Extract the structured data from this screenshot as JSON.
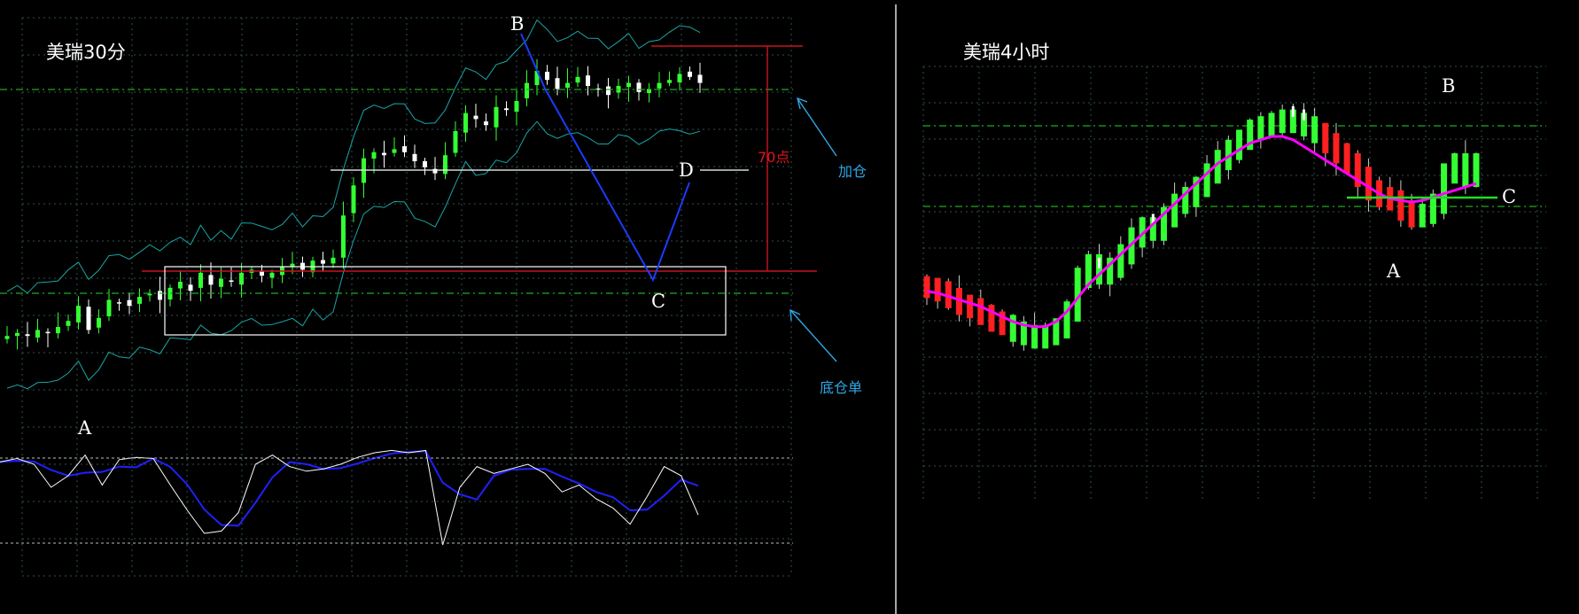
{
  "colors": {
    "background": "#000000",
    "bull_candle": "#33ff33",
    "bear_candle": "#ffffff",
    "bear_candle_4h": "#ff2020",
    "grid": "#2f4f4f",
    "band": "#1aa6a6",
    "stoch_main": "#ffffff",
    "stoch_signal": "#2020ff",
    "abcd_line": "#1a3cff",
    "level_red": "#c8141e",
    "level_green": "#22aa22",
    "annotation_cyan": "#2fa7e6",
    "ma_magenta": "#ff00ff",
    "divider": "#ffffff"
  },
  "left_panel": {
    "title": "美瑞30分",
    "labels": {
      "A": "A",
      "B": "B",
      "C": "C",
      "D": "D"
    },
    "distance_label": "70点",
    "add_position_label": "加仓",
    "base_position_label": "底仓单"
  },
  "right_panel": {
    "title": "美瑞4小时",
    "labels": {
      "A": "A",
      "B": "B",
      "C": "C"
    }
  },
  "chart_data": [
    {
      "type": "line",
      "title": "美瑞30分",
      "series": [
        {
          "values": [
            12,
            13,
            12,
            14,
            13,
            15,
            17,
            22,
            14,
            18,
            24,
            23,
            22,
            25,
            26,
            24,
            28,
            30,
            27,
            33,
            29,
            31,
            30,
            33,
            34,
            32,
            33,
            35,
            36,
            34,
            37,
            36,
            38,
            52,
            62,
            71,
            73,
            72,
            74,
            73,
            70,
            68,
            66,
            72,
            80,
            86,
            84,
            82,
            88,
            87,
            90,
            96,
            100,
            97,
            94,
            96,
            98,
            95,
            94,
            92,
            95,
            96,
            93,
            94,
            96,
            97,
            99,
            98,
            96
          ]
        }
      ],
      "stochastic": {
        "main": [
          82,
          85,
          80,
          60,
          70,
          88,
          62,
          84,
          86,
          85,
          62,
          40,
          20,
          22,
          38,
          80,
          88,
          78,
          74,
          76,
          80,
          86,
          90,
          92,
          90,
          92,
          10,
          60,
          78,
          72,
          76,
          80,
          72,
          56,
          62,
          50,
          42,
          28,
          52,
          78,
          70,
          36
        ]
      }
    },
    {
      "type": "line",
      "title": "美瑞4小时",
      "series": [
        {
          "values": [
            50,
            48,
            44,
            40,
            38,
            34,
            30,
            28,
            24,
            22,
            20,
            22,
            26,
            36,
            56,
            64,
            58,
            62,
            70,
            80,
            86,
            84,
            92,
            100,
            104,
            110,
            118,
            126,
            132,
            138,
            144,
            146,
            148,
            150,
            148,
            146,
            142,
            136,
            130,
            124,
            116,
            108,
            104,
            102,
            96,
            92,
            94,
            100,
            118,
            124,
            116,
            124
          ]
        }
      ],
      "moving_average": {
        "values": [
          48,
          47,
          45,
          43,
          41,
          39,
          36,
          33,
          30,
          28,
          27,
          27,
          30,
          36,
          44,
          52,
          58,
          64,
          70,
          76,
          82,
          88,
          94,
          100,
          106,
          112,
          118,
          124,
          128,
          132,
          136,
          138,
          140,
          140,
          138,
          134,
          130,
          126,
          122,
          118,
          114,
          110,
          106,
          103,
          102,
          101,
          102,
          104,
          106,
          108,
          110,
          112
        ]
      }
    }
  ]
}
